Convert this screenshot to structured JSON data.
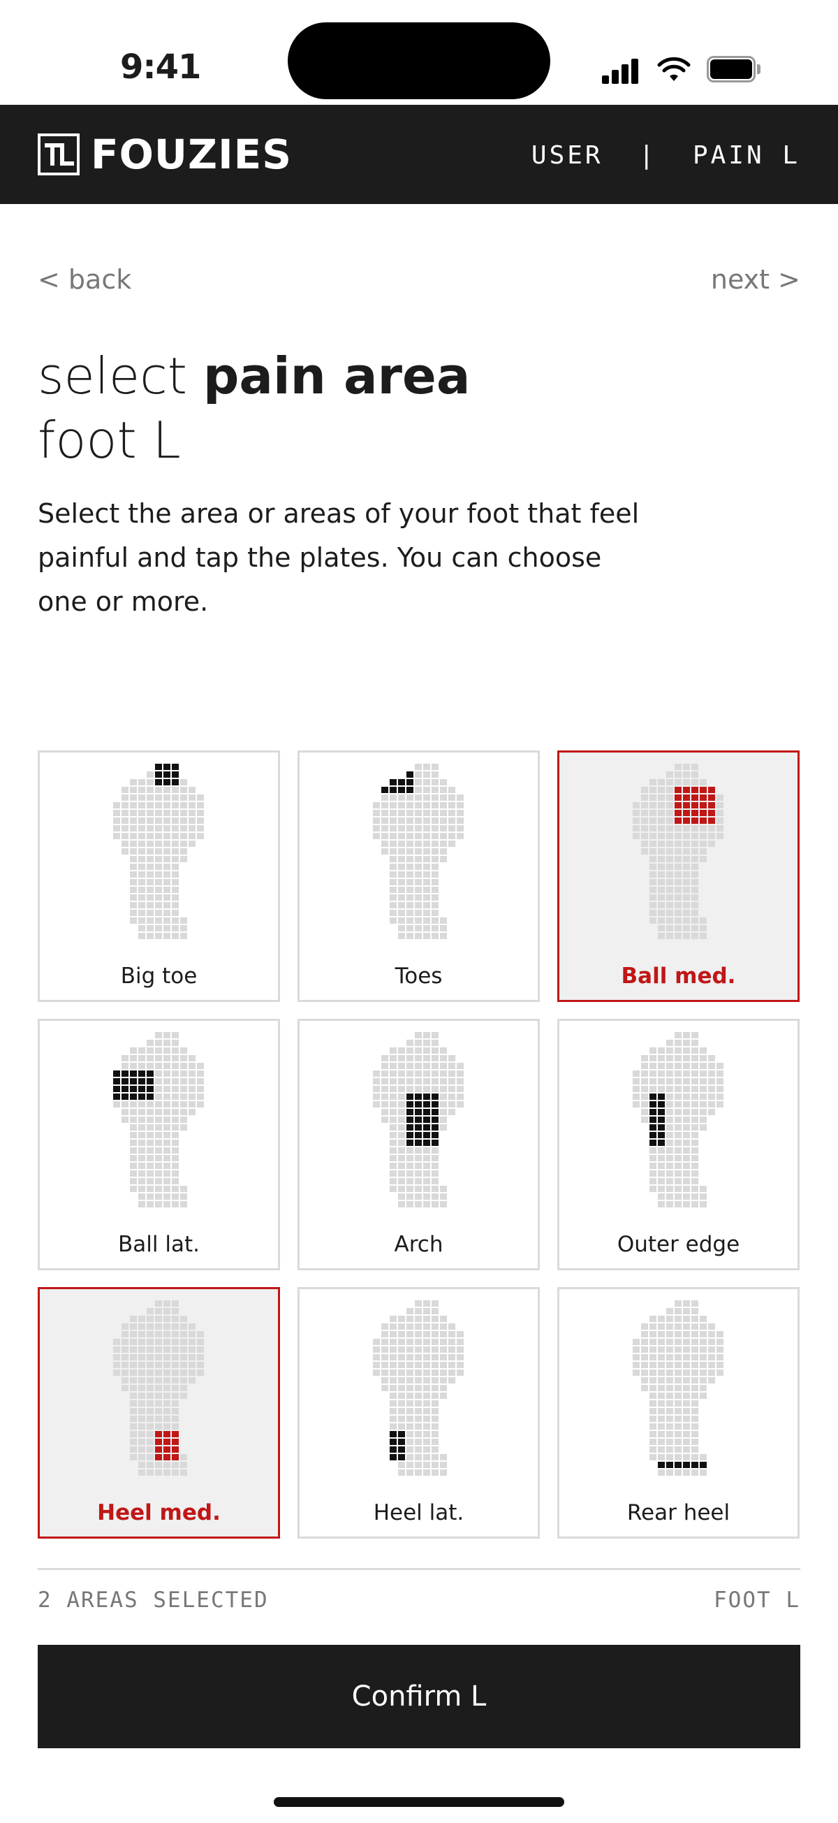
{
  "status_bar": {
    "time": "9:41"
  },
  "header": {
    "brand": "FOUZIES",
    "crumb": "USER  |  PAIN L"
  },
  "nav": {
    "back": "< back",
    "next": "next >"
  },
  "title": {
    "prefix": "select ",
    "emphasis": "pain area",
    "line2": "foot L"
  },
  "instructions": "Select the area or areas of your foot that feel painful and tap the plates. You can choose one or more.",
  "colors": {
    "dark": "#1c1c1c",
    "accent": "#c01717",
    "plate_off": "#d9d9d9",
    "plate_on": "#111111"
  },
  "areas": [
    {
      "id": "big-toe",
      "label": "Big toe",
      "selected": false,
      "icon": "foot-big-toe-icon"
    },
    {
      "id": "toes",
      "label": "Toes",
      "selected": false,
      "icon": "foot-toes-icon"
    },
    {
      "id": "ball-med",
      "label": "Ball med.",
      "selected": true,
      "icon": "foot-ball-med-icon"
    },
    {
      "id": "ball-lat",
      "label": "Ball lat.",
      "selected": false,
      "icon": "foot-ball-lat-icon"
    },
    {
      "id": "arch",
      "label": "Arch",
      "selected": false,
      "icon": "foot-arch-icon"
    },
    {
      "id": "outer-edge",
      "label": "Outer edge",
      "selected": false,
      "icon": "foot-outer-edge-icon"
    },
    {
      "id": "heel-med",
      "label": "Heel med.",
      "selected": true,
      "icon": "foot-heel-med-icon"
    },
    {
      "id": "heel-lat",
      "label": "Heel lat.",
      "selected": false,
      "icon": "foot-heel-lat-icon"
    },
    {
      "id": "rear-heel",
      "label": "Rear heel",
      "selected": false,
      "icon": "foot-rear-heel-icon"
    }
  ],
  "footer": {
    "selected_count": "2 AREAS SELECTED",
    "foot_side": "FOOT L"
  },
  "confirm_label": "Confirm L"
}
